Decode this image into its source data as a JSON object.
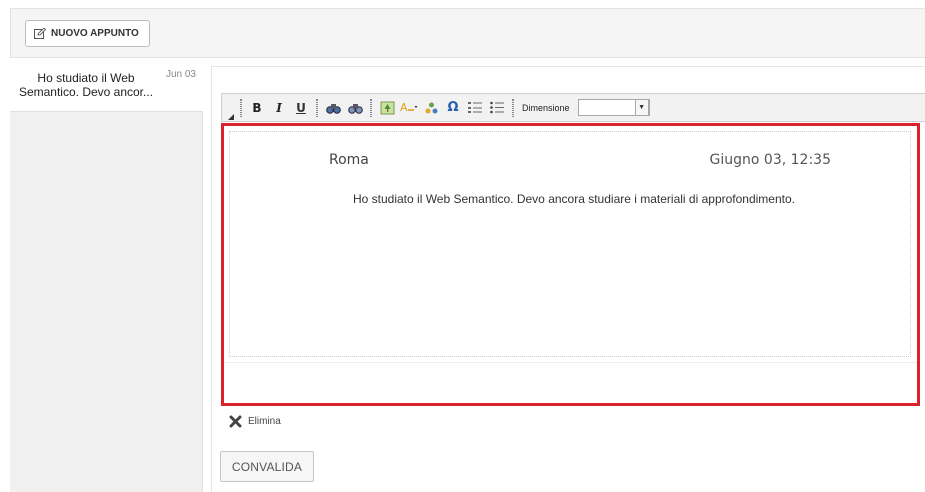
{
  "topbar": {
    "new_note_label": "NUOVO APPUNTO",
    "new_note_icon": "edit-icon"
  },
  "sidebar": {
    "items": [
      {
        "preview": "Ho studiato il Web Semantico. Devo ancor...",
        "date": "Jun 03"
      }
    ]
  },
  "toolbar": {
    "buttons": [
      "B",
      "I",
      "U"
    ],
    "size_label": "Dimensione",
    "size_value": ""
  },
  "editor": {
    "city": "Roma",
    "datetime": "Giugno 03, 12:35",
    "body": "Ho studiato il Web Semantico. Devo ancora studiare i materiali di approfondimento.",
    "highlight_color": "#d9232d"
  },
  "actions": {
    "delete_label": "Elimina",
    "validate_label": "CONVALIDA"
  }
}
